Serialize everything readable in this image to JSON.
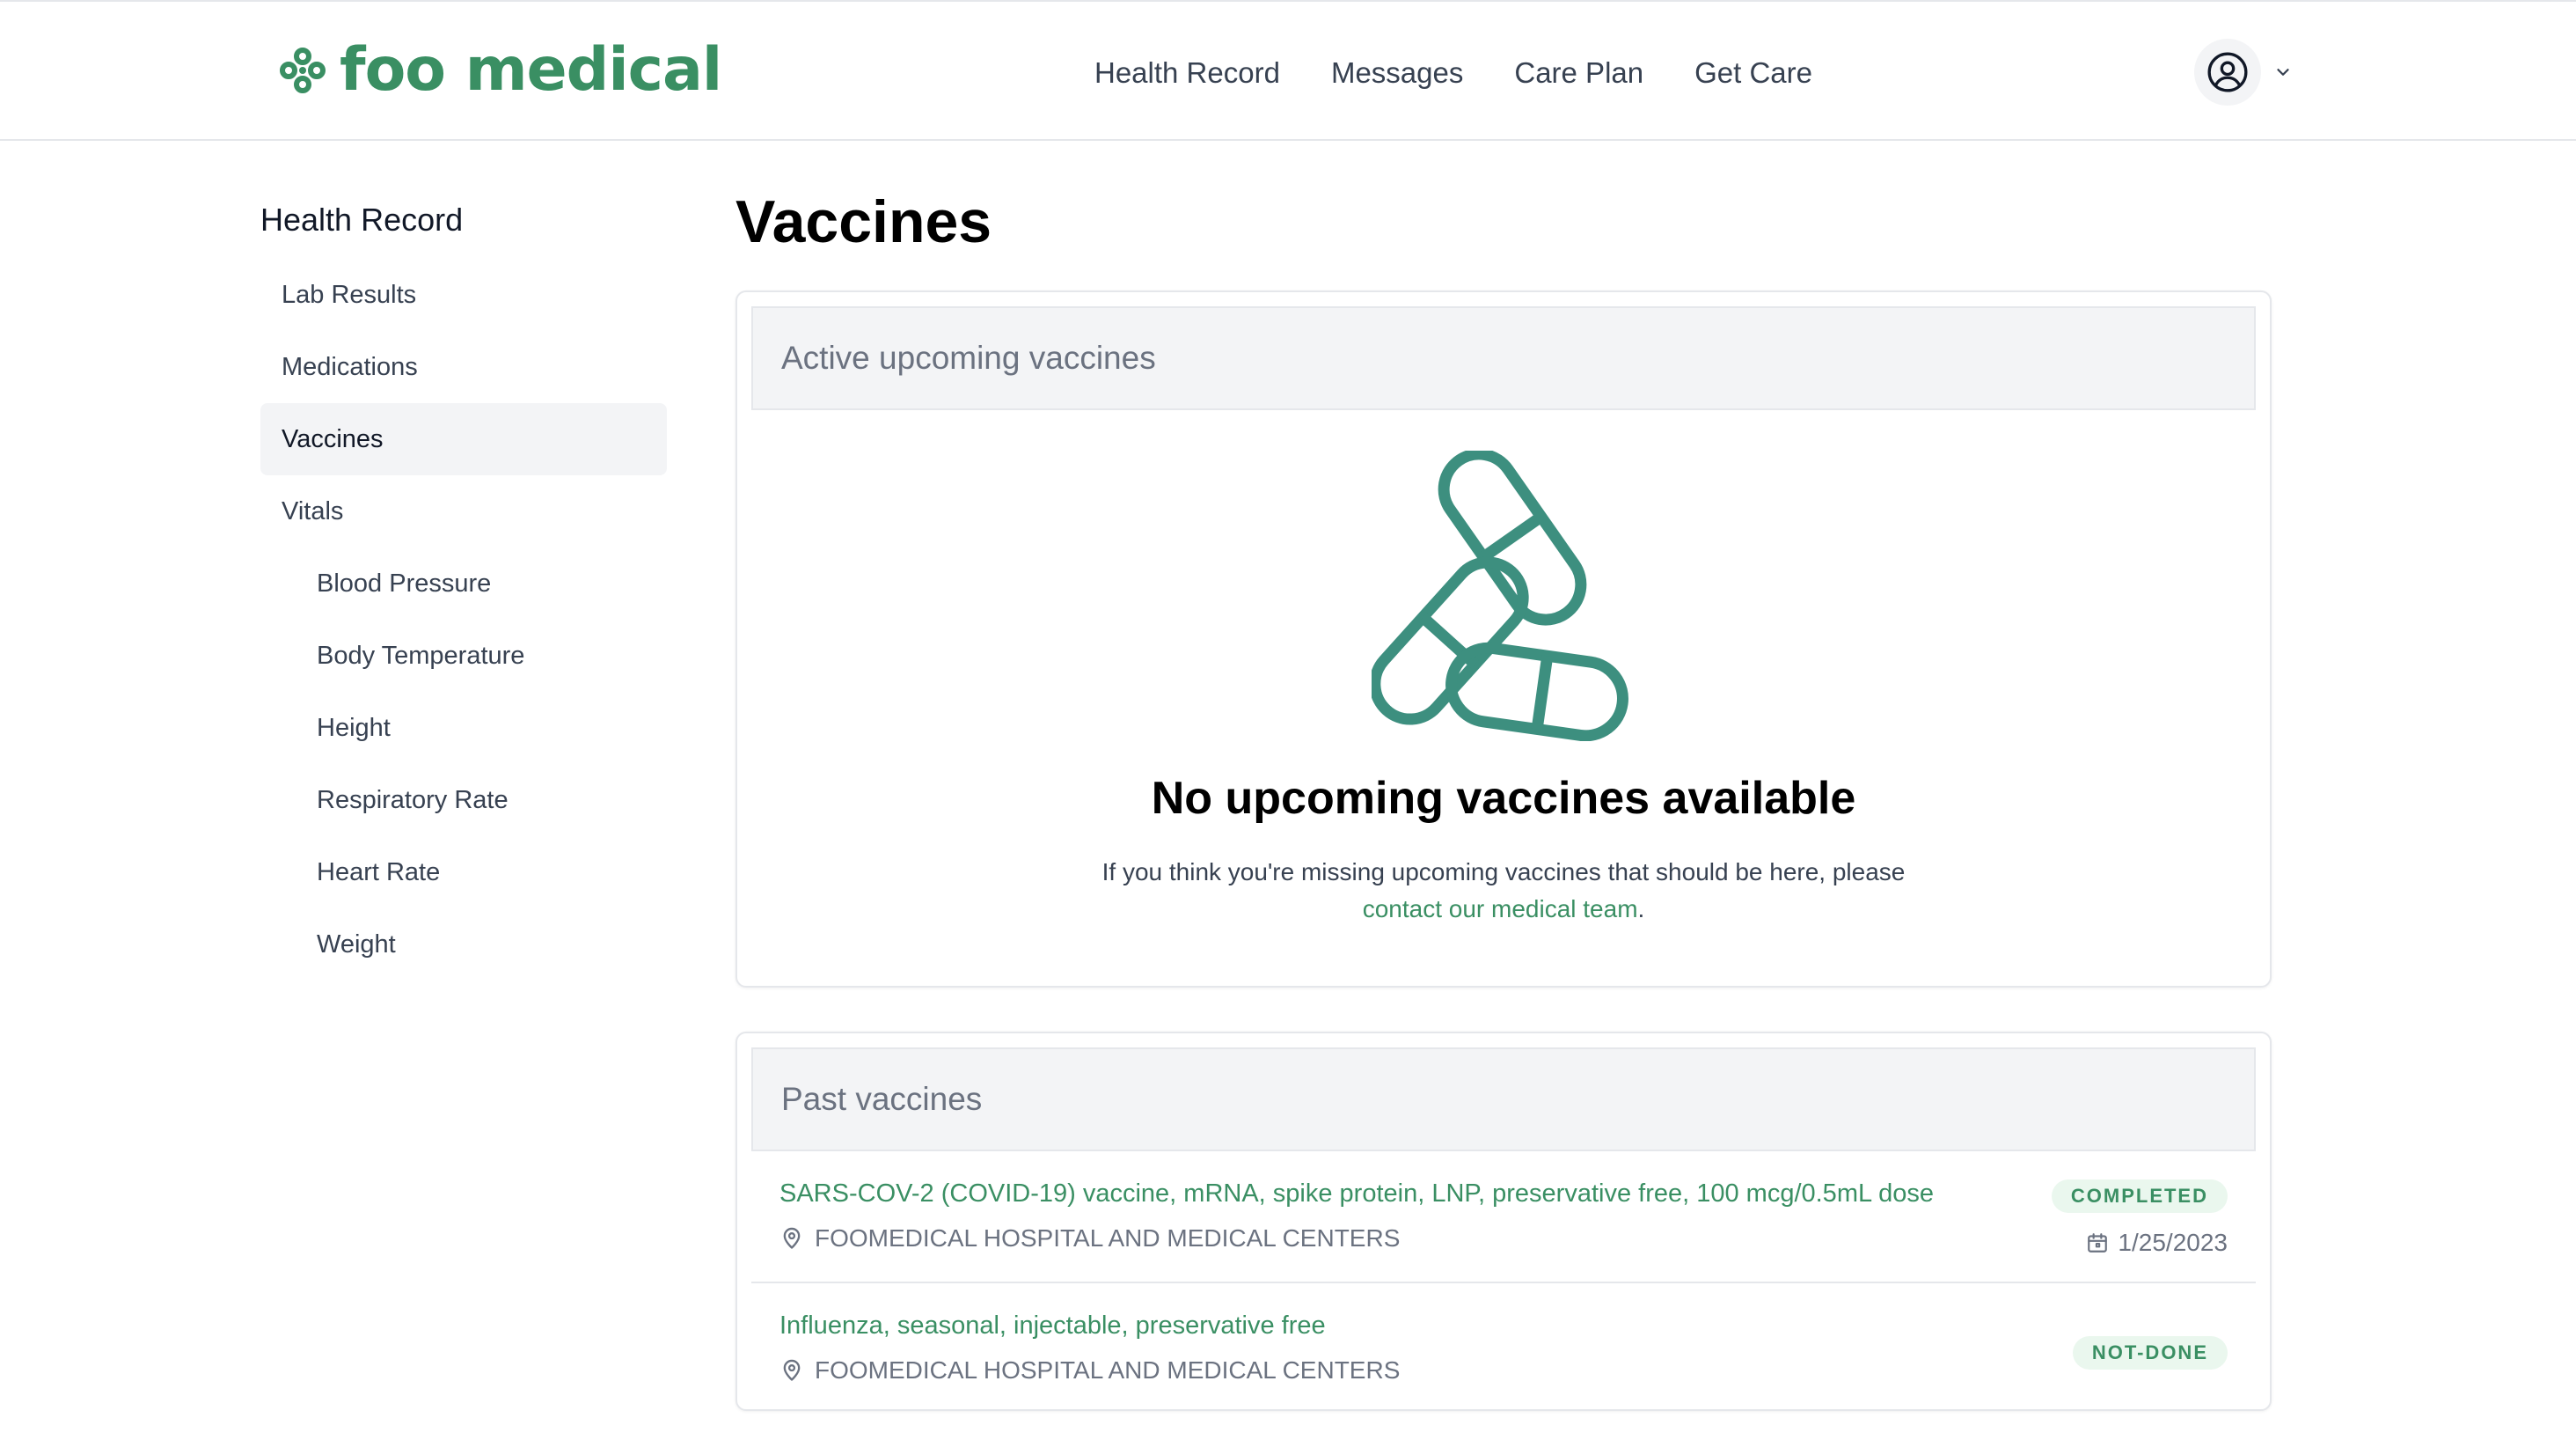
{
  "header": {
    "logo_text": "foo medical",
    "nav": [
      {
        "label": "Health Record"
      },
      {
        "label": "Messages"
      },
      {
        "label": "Care Plan"
      },
      {
        "label": "Get Care"
      }
    ],
    "icons": {
      "logo": "flower-logo-icon",
      "profile": "user-circle-icon",
      "chevron": "chevron-down-icon"
    }
  },
  "sidebar": {
    "title": "Health Record",
    "items": [
      {
        "label": "Lab Results"
      },
      {
        "label": "Medications"
      },
      {
        "label": "Vaccines"
      },
      {
        "label": "Vitals"
      },
      {
        "label": "Blood Pressure"
      },
      {
        "label": "Body Temperature"
      },
      {
        "label": "Height"
      },
      {
        "label": "Respiratory Rate"
      },
      {
        "label": "Heart Rate"
      },
      {
        "label": "Weight"
      }
    ]
  },
  "main": {
    "title": "Vaccines",
    "upcoming": {
      "header": "Active upcoming vaccines",
      "empty_icon": "pills-icon",
      "empty_title": "No upcoming vaccines available",
      "empty_text": "If you think you're missing upcoming vaccines that should be here, please",
      "contact_link": "contact our medical team",
      "contact_suffix": "."
    },
    "past": {
      "header": "Past vaccines",
      "rows": [
        {
          "name": "SARS-COV-2 (COVID-19) vaccine, mRNA, spike protein, LNP, preservative free, 100 mcg/0.5mL dose",
          "location": "FOOMEDICAL HOSPITAL AND MEDICAL CENTERS",
          "status": "COMPLETED",
          "date": "1/25/2023"
        },
        {
          "name": "Influenza, seasonal, injectable, preservative free",
          "location": "FOOMEDICAL HOSPITAL AND MEDICAL CENTERS",
          "status": "NOT-DONE"
        }
      ]
    }
  },
  "colors": {
    "brand": "#3a8f63",
    "pill_icon": "#3d8f7f",
    "badge_bg": "#eaf7ee",
    "active_bg": "#f3f4f6"
  }
}
